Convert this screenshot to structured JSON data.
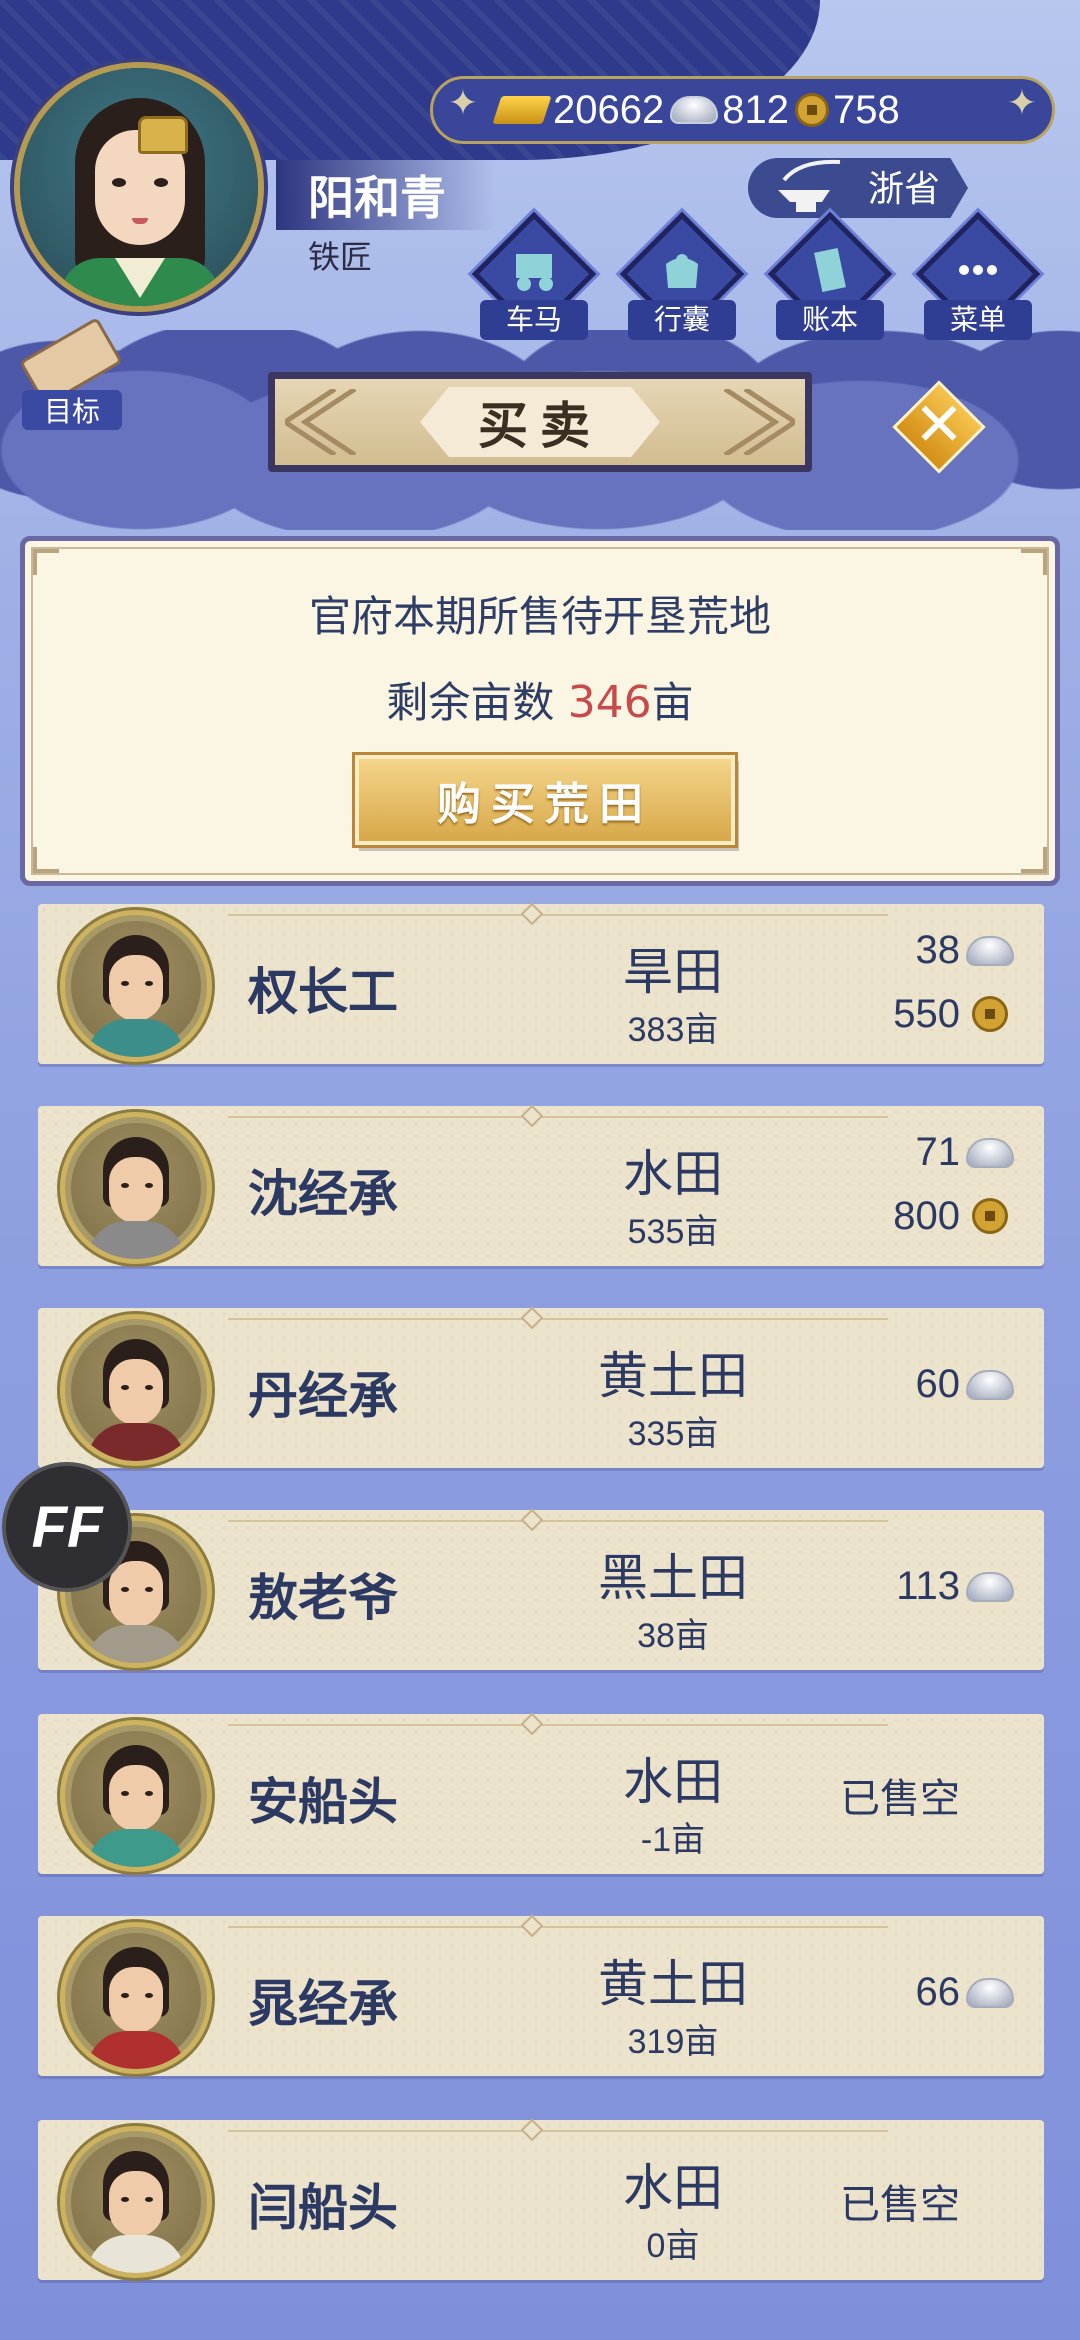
{
  "player": {
    "name": "阳和青",
    "title": "铁匠"
  },
  "currency": {
    "gold": "20662",
    "silver": "812",
    "copper": "758"
  },
  "province": "浙省",
  "menu": [
    {
      "label": "车马",
      "icon": "carriage-icon"
    },
    {
      "label": "行囊",
      "icon": "bundle-icon"
    },
    {
      "label": "账本",
      "icon": "ledger-icon"
    },
    {
      "label": "菜单",
      "icon": "more-icon"
    }
  ],
  "goal_label": "目标",
  "header_title": "买卖",
  "info": {
    "title": "官府本期所售待开垦荒地",
    "remain_label": "剩余亩数",
    "remain_value": "346",
    "remain_unit": "亩",
    "buy_button": "购买荒田"
  },
  "listings": [
    {
      "name": "权长工",
      "land_type": "旱田",
      "area": "383亩",
      "silver": "38",
      "copper": "550",
      "sold_out": null,
      "robe_color": "#3c8e8a"
    },
    {
      "name": "沈经承",
      "land_type": "水田",
      "area": "535亩",
      "silver": "71",
      "copper": "800",
      "sold_out": null,
      "robe_color": "#8a8a8a"
    },
    {
      "name": "丹经承",
      "land_type": "黄土田",
      "area": "335亩",
      "silver": "60",
      "copper": null,
      "sold_out": null,
      "robe_color": "#7a2a2a"
    },
    {
      "name": "敖老爷",
      "land_type": "黑土田",
      "area": "38亩",
      "silver": "113",
      "copper": null,
      "sold_out": null,
      "robe_color": "#a29a8a"
    },
    {
      "name": "安船头",
      "land_type": "水田",
      "area": "-1亩",
      "silver": null,
      "copper": null,
      "sold_out": "已售空",
      "robe_color": "#3e9a8a"
    },
    {
      "name": "晁经承",
      "land_type": "黄土田",
      "area": "319亩",
      "silver": "66",
      "copper": null,
      "sold_out": null,
      "robe_color": "#b03030"
    },
    {
      "name": "闫船头",
      "land_type": "水田",
      "area": "0亩",
      "silver": null,
      "copper": null,
      "sold_out": "已售空",
      "robe_color": "#e8e4d8"
    }
  ],
  "ff_label": "FF"
}
